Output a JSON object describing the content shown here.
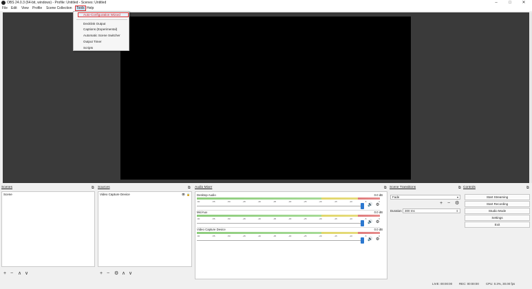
{
  "window": {
    "title": "OBS 24.0.3 (64-bit, windows) - Profile: Untitled - Scenes: Untitled",
    "minimize_glyph": "–",
    "maximize_glyph": "□",
    "close_glyph": "✕"
  },
  "menubar": {
    "file": "File",
    "edit": "Edit",
    "view": "View",
    "profile": "Profile",
    "scene_collection": "Scene Collection",
    "tools": "Tools",
    "help": "Help"
  },
  "tools_menu": {
    "items": [
      "Auto-Configuration Wizard",
      "Decklink Output",
      "Captions (Experimental)",
      "Automatic Scene Switcher",
      "Output Timer",
      "Scripts"
    ]
  },
  "scenes": {
    "title": "Scenes",
    "items": [
      "Scene"
    ],
    "toolbar": {
      "add": "+",
      "remove": "−",
      "up": "∧",
      "down": "∨"
    }
  },
  "sources": {
    "title": "Sources",
    "items": [
      "Video Capture Device"
    ],
    "toolbar": {
      "add": "+",
      "remove": "−",
      "settings": "⚙",
      "up": "∧",
      "down": "∨"
    }
  },
  "audio_mixer": {
    "title": "Audio Mixer",
    "channels": [
      {
        "name": "Desktop Audio",
        "db": "0.0 dB",
        "level": 0.9
      },
      {
        "name": "Mic/Aux",
        "db": "0.0 dB",
        "level": 0.9
      },
      {
        "name": "Video Capture Device",
        "db": "0.0 dB",
        "level": 0.9
      }
    ],
    "ticks": [
      "-60",
      "-55",
      "-50",
      "-45",
      "-40",
      "-35",
      "-30",
      "-25",
      "-20",
      "-15",
      "-10",
      "-5",
      "0"
    ]
  },
  "transitions": {
    "title": "Scene Transitions",
    "selected": "Fade",
    "add": "+",
    "remove": "−",
    "gear": "⚙",
    "duration_label": "Duration",
    "duration_value": "300 ms"
  },
  "controls": {
    "title": "Controls",
    "start_streaming": "Start Streaming",
    "start_recording": "Start Recording",
    "studio_mode": "Studio Mode",
    "settings": "Settings",
    "exit": "Exit"
  },
  "status": {
    "live": "LIVE: 00:00:00",
    "rec": "REC: 00:00:00",
    "cpu": "CPU: 0.3%, 30.00 fps"
  },
  "icons": {
    "dock_float": "⧉",
    "volume": "🔊",
    "eye": "👁",
    "lock": "🔒"
  }
}
